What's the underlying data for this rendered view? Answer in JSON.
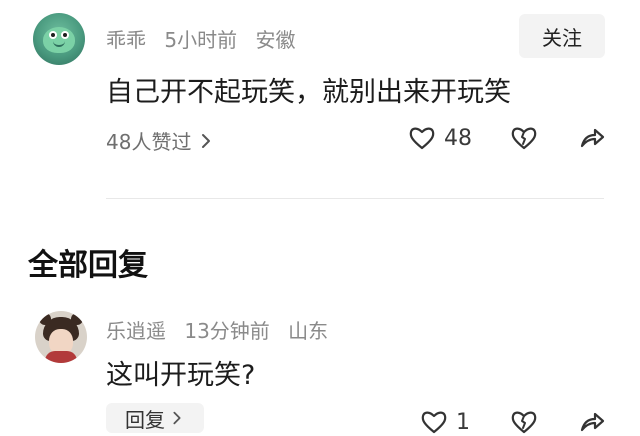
{
  "comment": {
    "username": "乖乖",
    "time": "5小时前",
    "location": "安徽",
    "follow_label": "关注",
    "text": "自己开不起玩笑，就别出来开玩笑",
    "likes_summary": "48人赞过",
    "like_count": "48"
  },
  "section": {
    "title": "全部回复"
  },
  "reply": {
    "username": "乐逍遥",
    "time": "13分钟前",
    "location": "山东",
    "text": "这叫开玩笑?",
    "reply_chip_label": "回复",
    "like_count": "1"
  },
  "icons": {
    "like": "heart-icon",
    "dislike": "broken-heart-icon",
    "share": "share-icon",
    "chevron": "chevron-right-icon"
  }
}
